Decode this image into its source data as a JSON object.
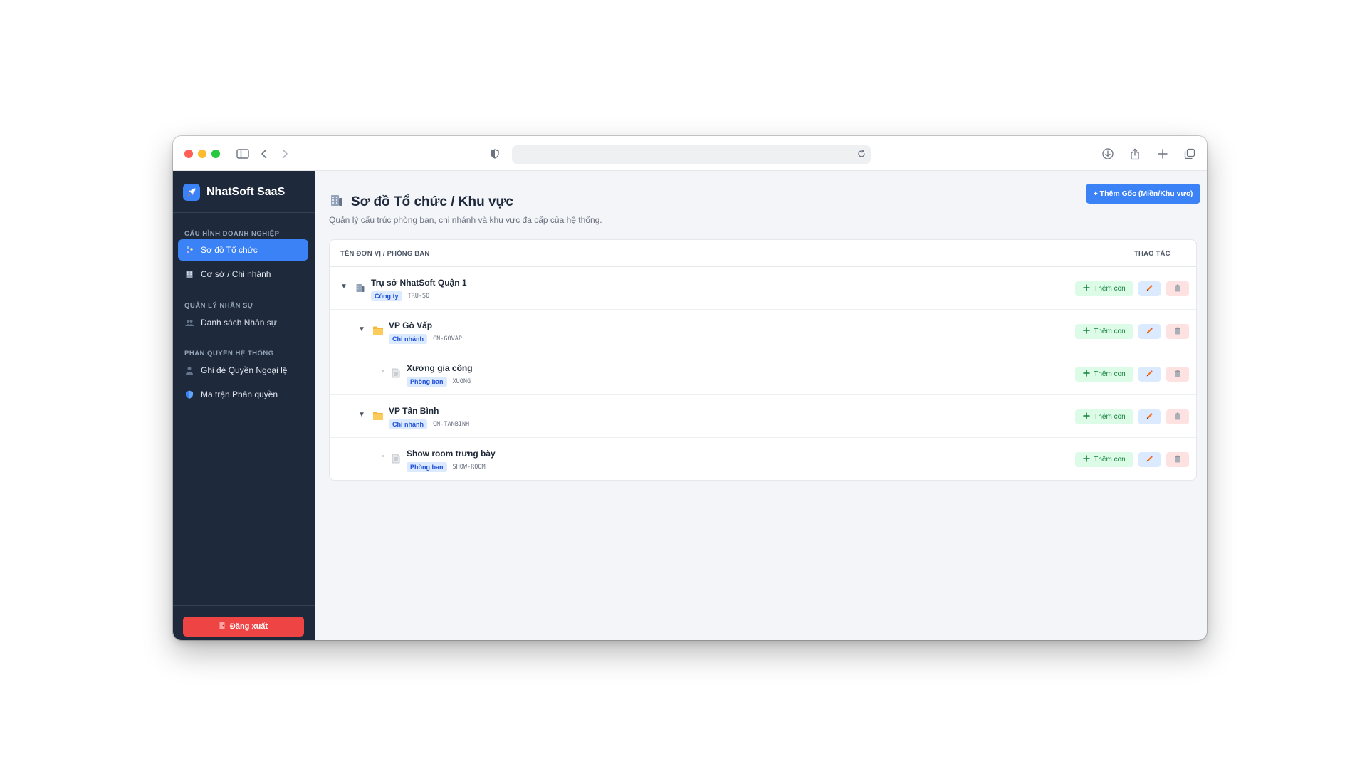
{
  "sidebar": {
    "brand": "NhatSoft SaaS",
    "sections": [
      {
        "title": "CẤU HÌNH DOANH NGHIỆP",
        "items": [
          {
            "label": "Sơ đồ Tổ chức",
            "icon": "org-chart-icon",
            "active": true
          },
          {
            "label": "Cơ sở / Chi nhánh",
            "icon": "building-icon"
          }
        ]
      },
      {
        "title": "QUẢN LÝ NHÂN SỰ",
        "items": [
          {
            "label": "Danh sách Nhân sự",
            "icon": "people-icon"
          }
        ]
      },
      {
        "title": "PHÂN QUYỀN HỆ THỐNG",
        "items": [
          {
            "label": "Ghi đè Quyền Ngoại lệ",
            "icon": "user-icon"
          },
          {
            "label": "Ma trận Phân quyền",
            "icon": "shield-icon"
          }
        ]
      }
    ],
    "logout_label": "Đăng xuất"
  },
  "header": {
    "title": "Sơ đồ Tổ chức / Khu vực",
    "subtitle": "Quản lý cấu trúc phòng ban, chi nhánh và khu vực đa cấp của hệ thống.",
    "add_root_label": "+ Thêm Gốc (Miền/Khu vực)"
  },
  "table": {
    "col_name": "TÊN ĐƠN VỊ / PHÒNG BAN",
    "col_actions": "THAO TÁC",
    "add_child_label": "Thêm con",
    "rows": [
      {
        "name": "Trụ sở NhatSoft Quận 1",
        "type": "Công ty",
        "code": "TRU-SO",
        "depth": 0,
        "expanded": true,
        "icon": "building-icon"
      },
      {
        "name": "VP Gò Vấp",
        "type": "Chi nhánh",
        "code": "CN-GOVAP",
        "depth": 1,
        "expanded": true,
        "icon": "folder-icon"
      },
      {
        "name": "Xưởng gia công",
        "type": "Phòng ban",
        "code": "XUONG",
        "depth": 2,
        "expanded": false,
        "icon": "document-icon"
      },
      {
        "name": "VP Tân Bình",
        "type": "Chi nhánh",
        "code": "CN-TANBINH",
        "depth": 1,
        "expanded": true,
        "icon": "folder-icon"
      },
      {
        "name": "Show room trưng bày",
        "type": "Phòng ban",
        "code": "SHOW-ROOM",
        "depth": 2,
        "expanded": false,
        "icon": "document-icon"
      }
    ]
  },
  "colors": {
    "accent": "#3b82f6",
    "sidebar_bg": "#1e293b",
    "danger": "#ef4444",
    "add_child_bg": "#dcfce7",
    "edit_bg": "#dbeafe",
    "delete_bg": "#fee2e2"
  }
}
